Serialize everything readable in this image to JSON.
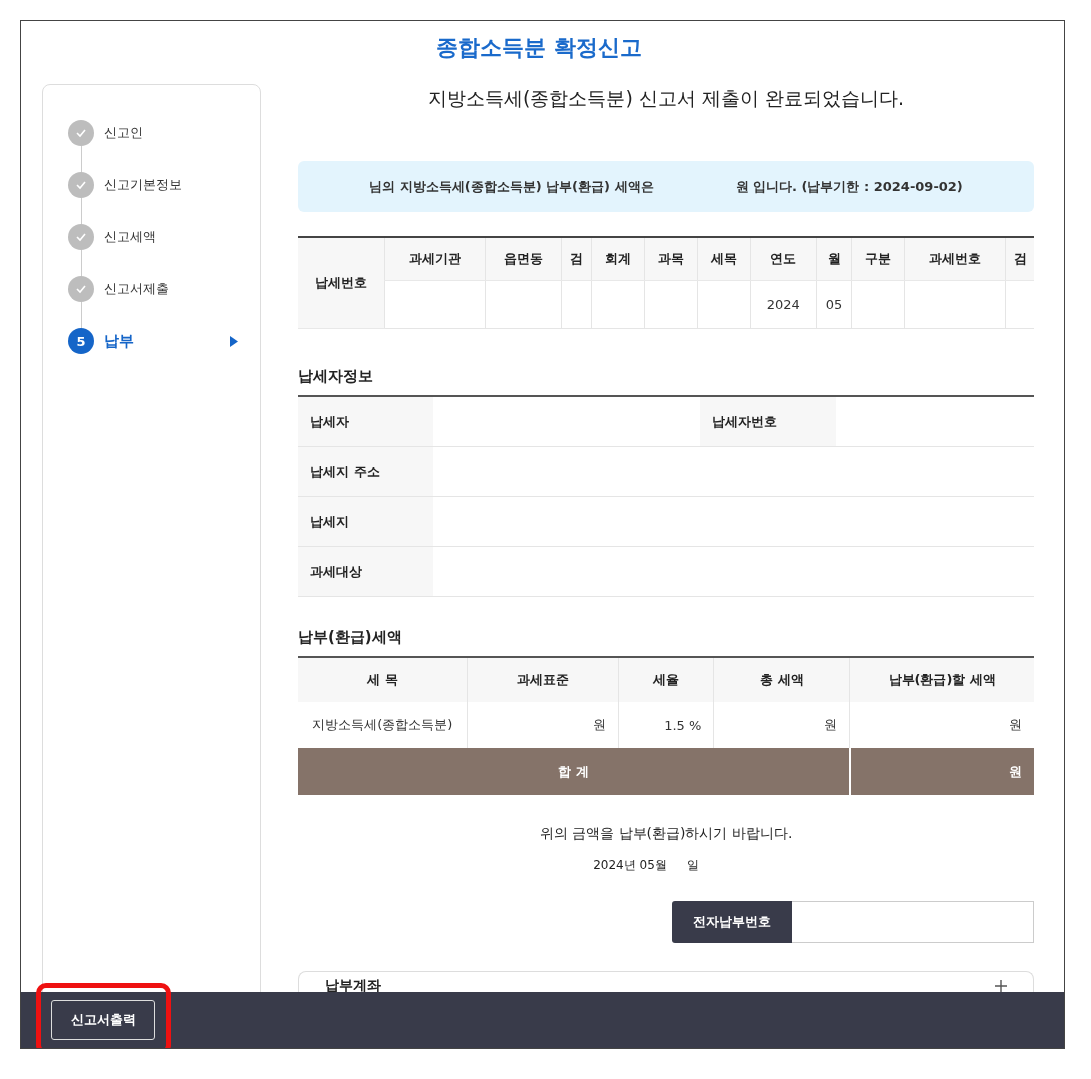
{
  "title": "종합소득분 확정신고",
  "sidebar": {
    "steps": [
      {
        "label": "신고인",
        "kind": "done",
        "selected": false
      },
      {
        "label": "신고기본정보",
        "kind": "done",
        "selected": false
      },
      {
        "label": "신고세액",
        "kind": "done",
        "selected": false
      },
      {
        "label": "신고서제출",
        "kind": "done",
        "selected": false
      },
      {
        "label": "납부",
        "kind": "current",
        "number": "5",
        "selected": true
      }
    ]
  },
  "completion_message": "지방소득세(종합소득분) 신고서 제출이 완료되었습니다.",
  "notice": {
    "before": "님의 지방소득세(종합소득분) 납부(환급) 세액은",
    "after": "원 입니다. (납부기한 : 2024-09-02)"
  },
  "tax_number_table": {
    "row_heading": "납세번호",
    "columns": [
      {
        "heading": "과세기관"
      },
      {
        "heading": "읍면동"
      },
      {
        "heading": "검"
      },
      {
        "heading": "회계"
      },
      {
        "heading": "과목"
      },
      {
        "heading": "세목"
      },
      {
        "heading": "연도",
        "value": "2024"
      },
      {
        "heading": "월",
        "value": "05"
      },
      {
        "heading": "구분"
      },
      {
        "heading": "과세번호"
      },
      {
        "heading": "검"
      }
    ]
  },
  "taxpayer_section": {
    "title": "납세자정보",
    "rows": [
      {
        "label": "납세자",
        "second_label": "납세자번호"
      },
      {
        "label": "납세지 주소"
      },
      {
        "label": "납세지"
      },
      {
        "label": "과세대상"
      }
    ]
  },
  "amount_section": {
    "title": "납부(환급)세액",
    "columns": [
      "세 목",
      "과세표준",
      "세율",
      "총 세액",
      "납부(환급)할 세액"
    ],
    "rows": [
      {
        "cells": [
          "지방소득세(종합소득분)",
          "원",
          "1.5 %",
          "원",
          "원"
        ]
      }
    ],
    "total": {
      "label": "합 계",
      "value": "원"
    }
  },
  "request_text": "위의 금액을 납부(환급)하시기 바랍니다.",
  "date": {
    "prefix": "2024년 05월",
    "suffix": "일"
  },
  "electronic_payment": {
    "label": "전자납부번호"
  },
  "account_panel": {
    "title": "납부계좌",
    "expanded": false
  },
  "footer": {
    "button": "신고서출력",
    "highlighted": true
  }
}
